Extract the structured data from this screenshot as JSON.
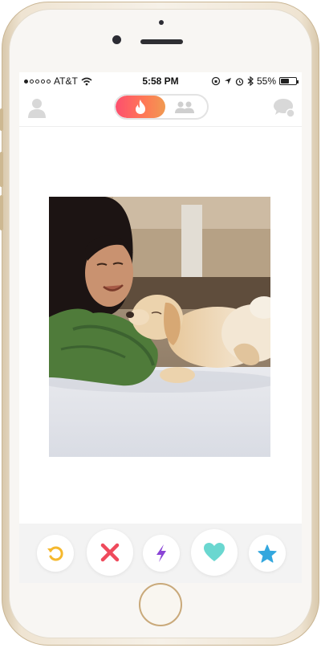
{
  "status_bar": {
    "carrier": "AT&T",
    "time": "5:58 PM",
    "battery": "55%",
    "battery_level": 0.55,
    "signal_bars": 1,
    "signal_total": 5
  },
  "nav": {
    "profile_icon": "profile-icon",
    "toggle_active_icon": "flame-icon",
    "toggle_inactive_icon": "group-icon",
    "chat_icon": "chat-icon",
    "brand_gradient_start": "#fd4f6e",
    "brand_gradient_end": "#f09a52"
  },
  "card": {
    "photo_icon": "profile-photo"
  },
  "actions": [
    {
      "name": "rewind-button",
      "icon": "rewind-icon",
      "color": "#f5b82e"
    },
    {
      "name": "nope-button",
      "icon": "x-icon",
      "color": "#ef4a5c"
    },
    {
      "name": "boost-button",
      "icon": "lightning-icon",
      "color": "#8a44d6"
    },
    {
      "name": "like-button",
      "icon": "heart-icon",
      "color": "#6ad7d0"
    },
    {
      "name": "super-like-button",
      "icon": "star-icon",
      "color": "#33a7de"
    }
  ]
}
